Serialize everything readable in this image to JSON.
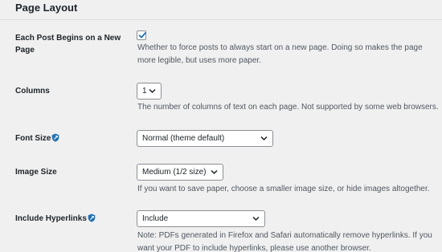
{
  "section": {
    "title": "Page Layout"
  },
  "rows": {
    "each_post": {
      "label": "Each Post Begins on a New Page",
      "checked": true,
      "description": "Whether to force posts to always start on a new page. Doing so makes the page more legible, but uses more paper."
    },
    "columns": {
      "label": "Columns",
      "value": "1",
      "description": "The number of columns of text on each page. Not supported by some web browsers."
    },
    "font_size": {
      "label": "Font Size",
      "value": "Normal (theme default)"
    },
    "image_size": {
      "label": "Image Size",
      "value": "Medium (1/2 size)",
      "description": "If you want to save paper, choose a smaller image size, or hide images altogether."
    },
    "hyperlinks": {
      "label": "Include Hyperlinks",
      "value": "Include",
      "description": "Note: PDFs generated in Firefox and Safari automatically remove hyperlinks. If you want your PDF to include hyperlinks, please use another browser."
    }
  },
  "icons": {
    "pro_badge": "shield-icon",
    "dropdown": "chevron-down-icon",
    "check": "checkmark-icon"
  },
  "colors": {
    "accent": "#2271b1",
    "background": "#f0f0f1",
    "text": "#1d2327",
    "muted": "#50575e"
  }
}
